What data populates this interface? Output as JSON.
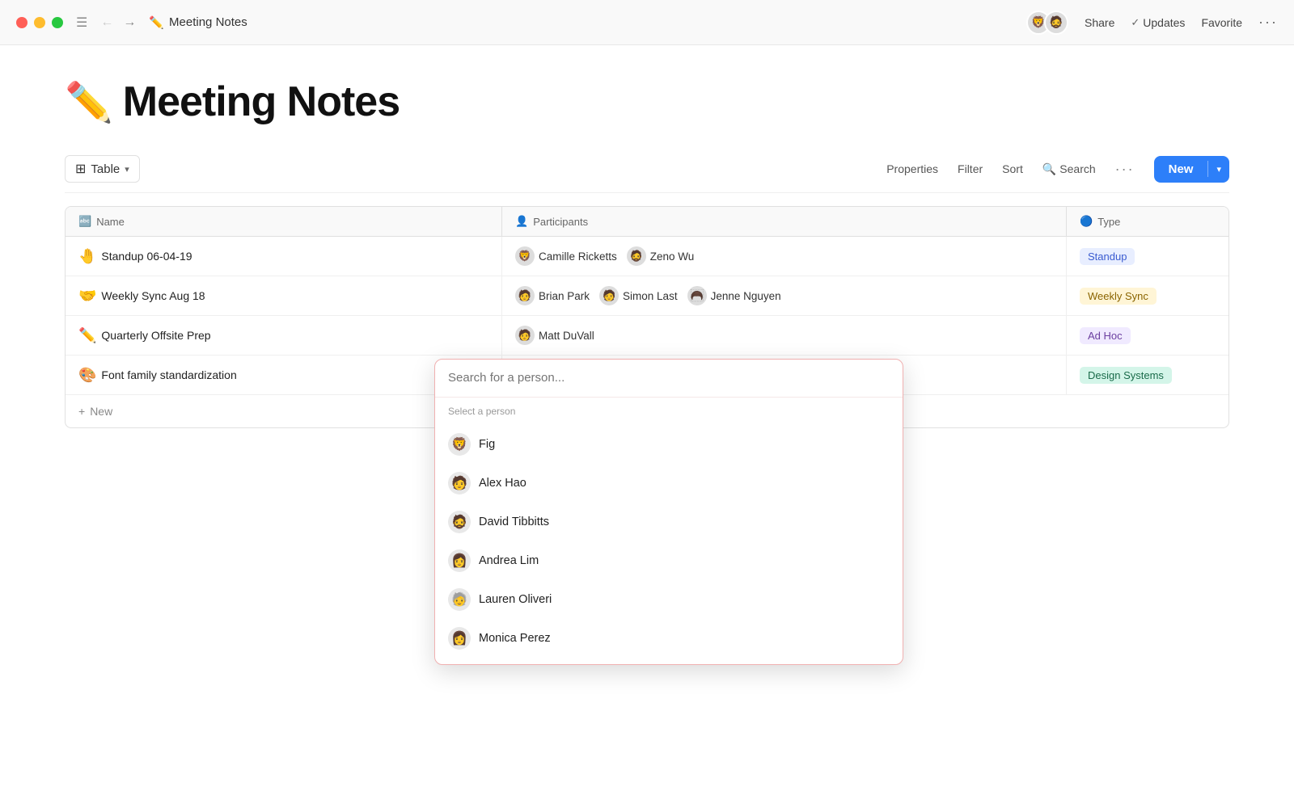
{
  "titlebar": {
    "page_emoji": "✏️",
    "page_title": "Meeting Notes",
    "share_label": "Share",
    "updates_label": "Updates",
    "favorite_label": "Favorite"
  },
  "toolbar": {
    "view_label": "Table",
    "properties_label": "Properties",
    "filter_label": "Filter",
    "sort_label": "Sort",
    "search_label": "Search",
    "new_label": "New"
  },
  "table": {
    "columns": [
      {
        "label": "Name",
        "icon": "🔤"
      },
      {
        "label": "Participants",
        "icon": "👤"
      },
      {
        "label": "Type",
        "icon": "🔵"
      }
    ],
    "rows": [
      {
        "emoji": "🤚",
        "name": "Standup 06-04-19",
        "participants": [
          {
            "avatar": "🦁",
            "name": "Camille Ricketts"
          },
          {
            "avatar": "🧔",
            "name": "Zeno Wu"
          }
        ],
        "type": "Standup",
        "badge_class": "badge-standup"
      },
      {
        "emoji": "🤝",
        "name": "Weekly Sync Aug 18",
        "participants": [
          {
            "avatar": "🧑",
            "name": "Brian Park"
          },
          {
            "avatar": "🧑",
            "name": "Simon Last"
          },
          {
            "avatar": "🦱",
            "name": "Jenne Nguyen"
          }
        ],
        "type": "Weekly Sync",
        "badge_class": "badge-weekly"
      },
      {
        "emoji": "✏️",
        "name": "Quarterly Offsite Prep",
        "participants": [
          {
            "avatar": "🧑",
            "name": "Matt DuVall"
          }
        ],
        "type": "Ad Hoc",
        "badge_class": "badge-adhoc"
      },
      {
        "emoji": "🎨",
        "name": "Font family standardization",
        "participants": [],
        "type": "Design Systems",
        "badge_class": "badge-design"
      }
    ],
    "new_row_label": "New"
  },
  "dropdown": {
    "search_placeholder": "Search for a person...",
    "section_label": "Select a person",
    "people": [
      {
        "avatar": "🦁",
        "name": "Fig"
      },
      {
        "avatar": "🧑",
        "name": "Alex Hao"
      },
      {
        "avatar": "🧔",
        "name": "David Tibbitts"
      },
      {
        "avatar": "👩",
        "name": "Andrea Lim"
      },
      {
        "avatar": "🧓",
        "name": "Lauren Oliveri"
      },
      {
        "avatar": "👩",
        "name": "Monica Perez"
      }
    ]
  },
  "page": {
    "emoji": "✏️",
    "title": "Meeting Notes"
  }
}
